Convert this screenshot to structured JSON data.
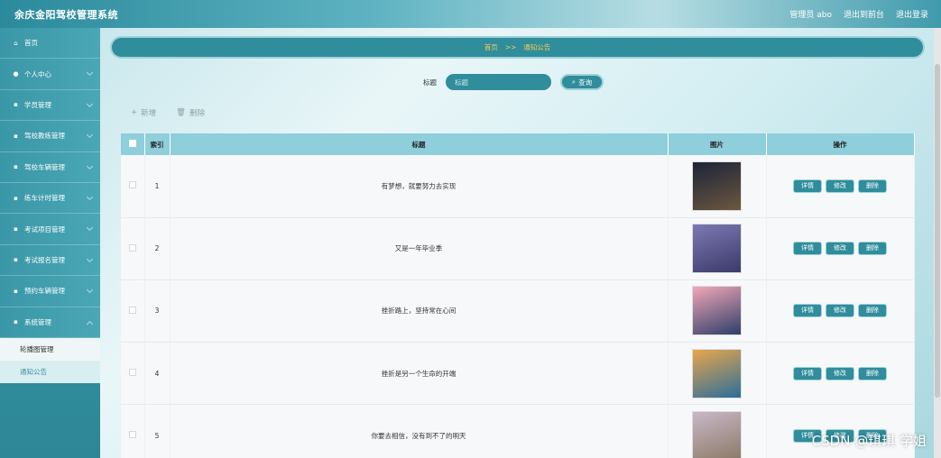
{
  "header": {
    "title": "余庆金阳驾校管理系统",
    "links": [
      "管理员 abo",
      "退出到前台",
      "退出登录"
    ]
  },
  "sidebar": {
    "items": [
      {
        "label": "首页",
        "icon": "home-icon"
      },
      {
        "label": "个人中心",
        "icon": "user-icon"
      },
      {
        "label": "学员管理",
        "icon": "grid-icon"
      },
      {
        "label": "驾校教练管理",
        "icon": "grid-icon"
      },
      {
        "label": "驾校车辆管理",
        "icon": "grid-icon"
      },
      {
        "label": "练车计时管理",
        "icon": "grid-icon"
      },
      {
        "label": "考试项目管理",
        "icon": "grid-icon"
      },
      {
        "label": "考试报名管理",
        "icon": "grid-icon"
      },
      {
        "label": "预约车辆管理",
        "icon": "grid-icon"
      },
      {
        "label": "系统管理",
        "icon": "grid-icon"
      }
    ],
    "sub_items": [
      "轮播图管理",
      "通知公告"
    ]
  },
  "breadcrumb": {
    "home": "首页",
    "sep": ">>",
    "current": "通知公告"
  },
  "search": {
    "label": "标题",
    "placeholder": "标题",
    "button": "查询"
  },
  "actions": {
    "add": "新增",
    "delete": "删除"
  },
  "table": {
    "headers": [
      "索引",
      "标题",
      "图片",
      "操作"
    ],
    "rows": [
      {
        "index": "1",
        "title": "有梦想，就要努力去实现",
        "img": "night-sky-photo",
        "colors": [
          "#1c2438",
          "#6c5740"
        ]
      },
      {
        "index": "2",
        "title": "又是一年毕业季",
        "img": "dusk-pier-photo",
        "colors": [
          "#7d79b3",
          "#3b3a6a"
        ]
      },
      {
        "index": "3",
        "title": "挫折路上，坚持常在心间",
        "img": "pink-clouds-photo",
        "colors": [
          "#f2a7b7",
          "#2e3e6a"
        ]
      },
      {
        "index": "4",
        "title": "挫折是另一个生命的开端",
        "img": "coast-road-photo",
        "colors": [
          "#e8a64a",
          "#2c6e9b"
        ]
      },
      {
        "index": "5",
        "title": "你要去相信，没有到不了的明天",
        "img": "rainbow-path-photo",
        "colors": [
          "#c9b7c9",
          "#8c7a66"
        ]
      }
    ],
    "row_buttons": [
      "详情",
      "修改",
      "删除"
    ]
  },
  "watermark": "CSDN @琪琪 学姐"
}
